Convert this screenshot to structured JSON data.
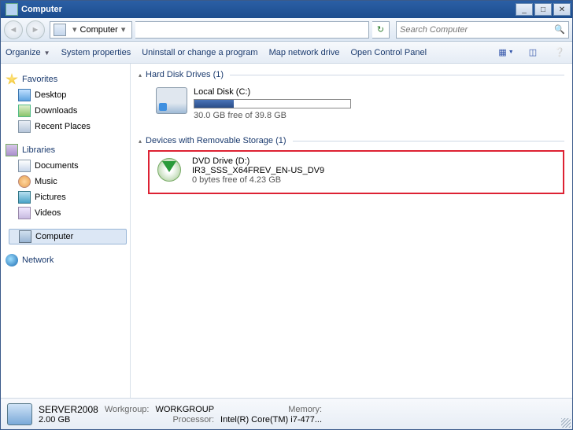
{
  "window": {
    "title": "Computer"
  },
  "nav": {
    "breadcrumb": "Computer",
    "search_placeholder": "Search Computer"
  },
  "toolbar": {
    "organize": "Organize",
    "sysprops": "System properties",
    "uninstall": "Uninstall or change a program",
    "mapdrive": "Map network drive",
    "controlpanel": "Open Control Panel"
  },
  "sidebar": {
    "favorites": {
      "label": "Favorites",
      "items": [
        "Desktop",
        "Downloads",
        "Recent Places"
      ]
    },
    "libraries": {
      "label": "Libraries",
      "items": [
        "Documents",
        "Music",
        "Pictures",
        "Videos"
      ]
    },
    "computer": {
      "label": "Computer"
    },
    "network": {
      "label": "Network"
    }
  },
  "sections": {
    "hdd": {
      "header": "Hard Disk Drives (1)",
      "drive": {
        "name": "Local Disk (C:)",
        "status": "30.0 GB free of 39.8 GB",
        "used_pct": 25
      }
    },
    "removable": {
      "header": "Devices with Removable Storage (1)",
      "drive": {
        "name": "DVD Drive (D:)",
        "label": "IR3_SSS_X64FREV_EN-US_DV9",
        "status": "0 bytes free of 4.23 GB"
      }
    }
  },
  "status": {
    "name": "SERVER2008",
    "workgroup_lbl": "Workgroup:",
    "workgroup_val": "WORKGROUP",
    "memory_lbl": "Memory:",
    "memory_val": "2.00 GB",
    "processor_lbl": "Processor:",
    "processor_val": "Intel(R) Core(TM) i7-477..."
  }
}
